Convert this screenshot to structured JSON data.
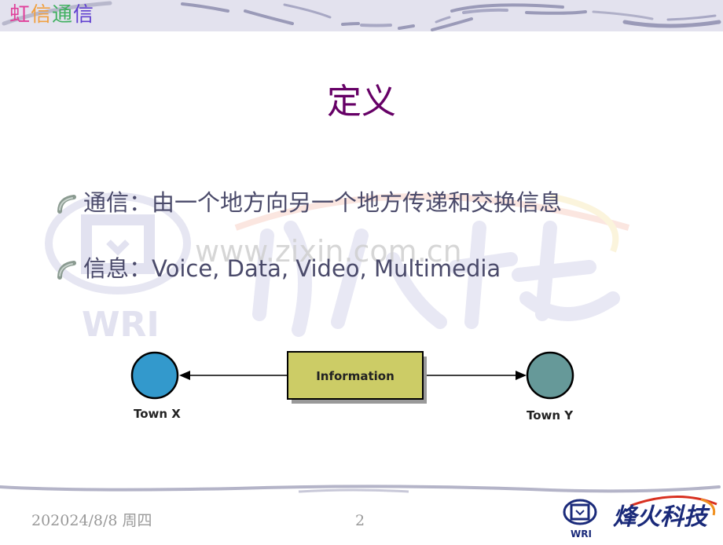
{
  "header": {
    "brand_chars": [
      "虹",
      "信",
      "通",
      "信"
    ],
    "brand_colors": [
      "#e0409a",
      "#f0a040",
      "#40b060",
      "#6040d0"
    ]
  },
  "slide": {
    "title": "定义",
    "title_color": "#660066",
    "bullets": [
      {
        "text": "通信：由一个地方向另一个地方传递和交换信息"
      },
      {
        "text": "信息：Voice, Data, Video, Multimedia"
      }
    ],
    "watermark_text": "www.zixin.com.cn",
    "watermark_logo_label": "WRI"
  },
  "diagram": {
    "left_node": {
      "label": "Town X",
      "color": "#3399cc"
    },
    "center_box": {
      "label": "Information",
      "color": "#cccc66"
    },
    "right_node": {
      "label": "Town Y",
      "color": "#669999"
    }
  },
  "footer": {
    "date": "202024/8/8 周四",
    "page_number": "2",
    "logo_label": "WRI",
    "logo_text": "烽火科技"
  }
}
